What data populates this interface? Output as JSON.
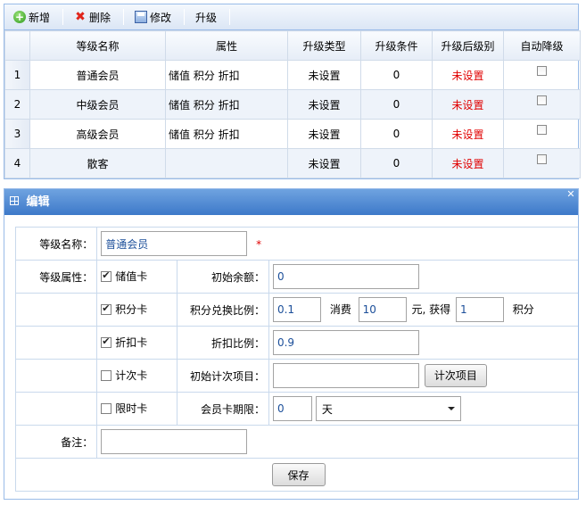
{
  "toolbar": {
    "add_label": "新增",
    "delete_label": "删除",
    "edit_label": "修改",
    "upgrade_label": "升级"
  },
  "grid": {
    "columns": [
      "等级名称",
      "属性",
      "升级类型",
      "升级条件",
      "升级后级别",
      "自动降级"
    ],
    "rows": [
      {
        "index": "1",
        "name": "普通会员",
        "attrs": "储值 积分 折扣",
        "upgrade_type": "未设置",
        "condition": "0",
        "next_level": "未设置",
        "auto_downgrade": false
      },
      {
        "index": "2",
        "name": "中级会员",
        "attrs": "储值 积分 折扣",
        "upgrade_type": "未设置",
        "condition": "0",
        "next_level": "未设置",
        "auto_downgrade": false
      },
      {
        "index": "3",
        "name": "高级会员",
        "attrs": "储值 积分 折扣",
        "upgrade_type": "未设置",
        "condition": "0",
        "next_level": "未设置",
        "auto_downgrade": false
      },
      {
        "index": "4",
        "name": "散客",
        "attrs": "",
        "upgrade_type": "未设置",
        "condition": "0",
        "next_level": "未设置",
        "auto_downgrade": false
      }
    ]
  },
  "dialog": {
    "title": "编辑",
    "level_name_label": "等级名称：",
    "level_name_value": "普通会员",
    "required_mark": "*",
    "level_attr_label": "等级属性：",
    "stored_value": {
      "label": "储值卡",
      "checked": true,
      "field_label": "初始余额：",
      "value": "0"
    },
    "points": {
      "label": "积分卡",
      "checked": true,
      "field_label": "积分兑换比例：",
      "spend_value": "0.1",
      "spend_text": "消费",
      "amount_value": "10",
      "yuan_text": "元, 获得",
      "points_value": "1",
      "points_text": "积分"
    },
    "discount": {
      "label": "折扣卡",
      "checked": true,
      "field_label": "折扣比例：",
      "value": "0.9"
    },
    "count_card": {
      "label": "计次卡",
      "checked": false,
      "field_label": "初始计次项目：",
      "value": "",
      "button_label": "计次项目"
    },
    "timed_card": {
      "label": "限时卡",
      "checked": false,
      "field_label": "会员卡期限：",
      "value": "0",
      "unit_selected": "天"
    },
    "remark_label": "备注：",
    "remark_value": "",
    "save_label": "保存"
  },
  "colors": {
    "accent": "#3d79c9",
    "border": "#99bbe8",
    "red": "#e00000"
  }
}
